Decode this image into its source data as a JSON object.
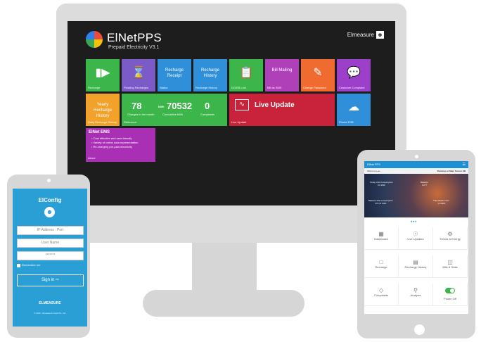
{
  "desktop": {
    "app_name": "ElNetPPS",
    "subtitle": "Prepaid Electricity V3.1",
    "user": "Elmeasure",
    "tiles": [
      {
        "label": "Recharge",
        "icon": "plug-icon",
        "color": "#3cb54a"
      },
      {
        "label": "Pending Recharges",
        "icon": "hourglass-icon",
        "color": "#7a5bc8"
      },
      {
        "label": "Status",
        "text": "Recharge Receipt",
        "color": "#2f8fd8"
      },
      {
        "label": "Recharge History",
        "text": "Recharge History",
        "color": "#2f8fd8"
      },
      {
        "label": "DG/EB Link",
        "icon": "clipboard-icon",
        "color": "#3cb54a"
      },
      {
        "label": "Bill as SMS",
        "text": "Bill Mailing",
        "color": "#b040b8"
      },
      {
        "label": "Change Password",
        "icon": "pencil-icon",
        "color": "#f06b30"
      },
      {
        "label": "Customer Complaint",
        "icon": "chat-icon",
        "color": "#9c3fc9"
      },
      {
        "label": "Daily Recharge History",
        "text": "Yearly Recharge History",
        "color": "#f2a12b"
      },
      {
        "label": "Reference",
        "value": "78",
        "caption": "Charges to the month",
        "color": "#3cb54a"
      },
      {
        "label": "",
        "value": "70532",
        "prefix": "kWh",
        "caption": "Cumulative kWh",
        "color": "#3cb54a"
      },
      {
        "label": "",
        "value": "0",
        "caption": "Complaints",
        "color": "#3cb54a"
      },
      {
        "label": "Live Update",
        "text": "Live Update",
        "icon": "pulse-icon",
        "color": "#c8233a"
      },
      {
        "label": "Phone ESB",
        "icon": "cloud-icon",
        "color": "#2f8fd8"
      }
    ],
    "ems": {
      "title": "ElNet EMS",
      "bullets": [
        "Cost effective and user friendly",
        "Variety of online data representation",
        "Re-charging pre-paid electricity"
      ],
      "label": "About"
    }
  },
  "phone": {
    "title": "ElConfig",
    "ip_placeholder": "IP Address : Port",
    "user_placeholder": "User Name",
    "password_value": "*******",
    "remember_label": "Remember me",
    "signin_label": "Sign in",
    "brand": "ELMEASURE",
    "copyright": "© 2015 - Elmeasure India Pvt. Ltd."
  },
  "tablet": {
    "app_title": "ElNet PPS",
    "welcome": "Welcome Lee...",
    "status": "Running on Main Source EB",
    "banner_stats": [
      {
        "label": "Today Unit Consumption",
        "value": "0.0 kWh"
      },
      {
        "label": "Balance",
        "value": "0.0 ₹"
      },
      {
        "label": "Balance DG Consumption",
        "value": "272.47 kWh"
      },
      {
        "label": "This Month Cons.",
        "value": "1.0 kWh"
      }
    ],
    "menu": [
      {
        "label": "Dashboard",
        "icon": "dashboard-icon"
      },
      {
        "label": "Live Updates",
        "icon": "live-icon"
      },
      {
        "label": "Trends & Energy",
        "icon": "trend-icon"
      },
      {
        "label": "Recharge",
        "icon": "recharge-icon"
      },
      {
        "label": "Recharge History",
        "icon": "history-icon"
      },
      {
        "label": "Bills & Stats",
        "icon": "bill-icon"
      },
      {
        "label": "Complaints",
        "icon": "complaint-icon"
      },
      {
        "label": "Analysis",
        "icon": "analysis-icon"
      },
      {
        "label": "Power Off",
        "icon": "toggle-icon"
      }
    ]
  }
}
